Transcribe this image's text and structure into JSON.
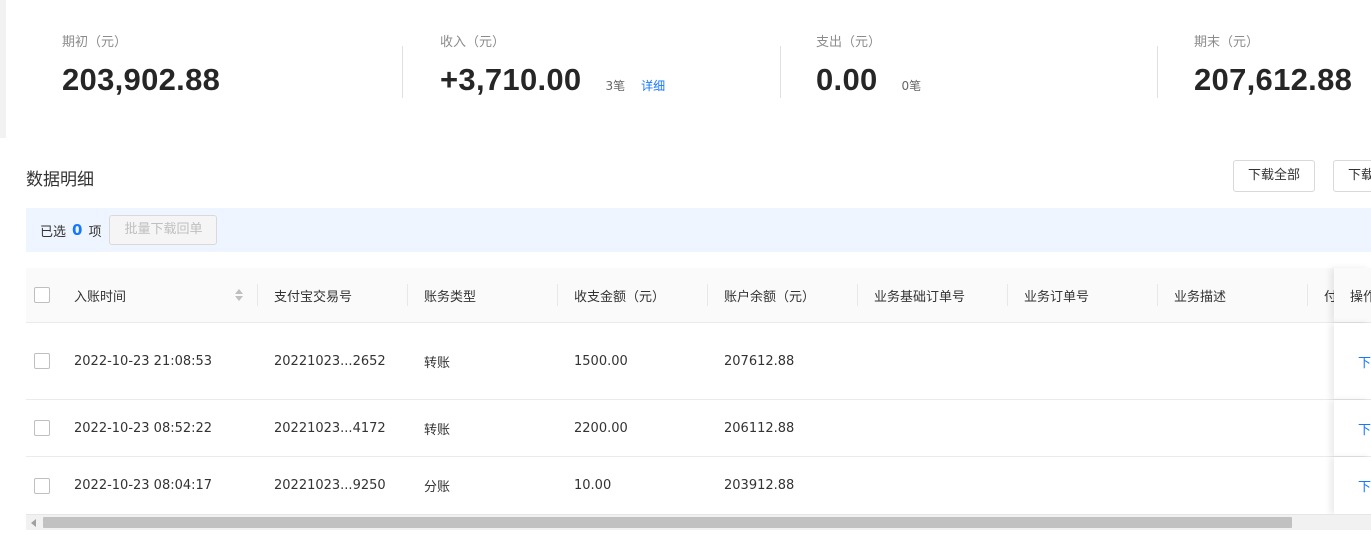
{
  "summary": {
    "opening": {
      "label": "期初（元）",
      "value": "203,902.88"
    },
    "income": {
      "label": "收入（元）",
      "value": "+3,710.00",
      "count": "3笔",
      "link": "详细"
    },
    "expense": {
      "label": "支出（元）",
      "value": "0.00",
      "count": "0笔"
    },
    "closing": {
      "label": "期末（元）",
      "value": "207,612.88"
    }
  },
  "section": {
    "title": "数据明细",
    "download_all": "下载全部",
    "download_partial": "下载"
  },
  "selection": {
    "prefix": "已选",
    "count": "0",
    "suffix": "项",
    "batch_button": "批量下载回单"
  },
  "table": {
    "columns": {
      "time": "入账时间",
      "alipay_no": "支付宝交易号",
      "type": "账务类型",
      "amount": "收支金额（元）",
      "balance": "账户余额（元）",
      "base_order": "业务基础订单号",
      "order": "业务订单号",
      "desc": "业务描述",
      "payer": "付",
      "action": "操作"
    },
    "rows": [
      {
        "time": "2022-10-23 21:08:53",
        "alipay_no": "20221023...2652",
        "type": "转账",
        "amount": "1500.00",
        "balance": "207612.88",
        "action": "下"
      },
      {
        "time": "2022-10-23 08:52:22",
        "alipay_no": "20221023...4172",
        "type": "转账",
        "amount": "2200.00",
        "balance": "206112.88",
        "action": "下"
      },
      {
        "time": "2022-10-23 08:04:17",
        "alipay_no": "20221023...9250",
        "type": "分账",
        "amount": "10.00",
        "balance": "203912.88",
        "action": "下"
      }
    ]
  },
  "colors": {
    "accent": "#1677ff",
    "selection_bg": "#eef5ff",
    "header_bg": "#fafafa"
  }
}
